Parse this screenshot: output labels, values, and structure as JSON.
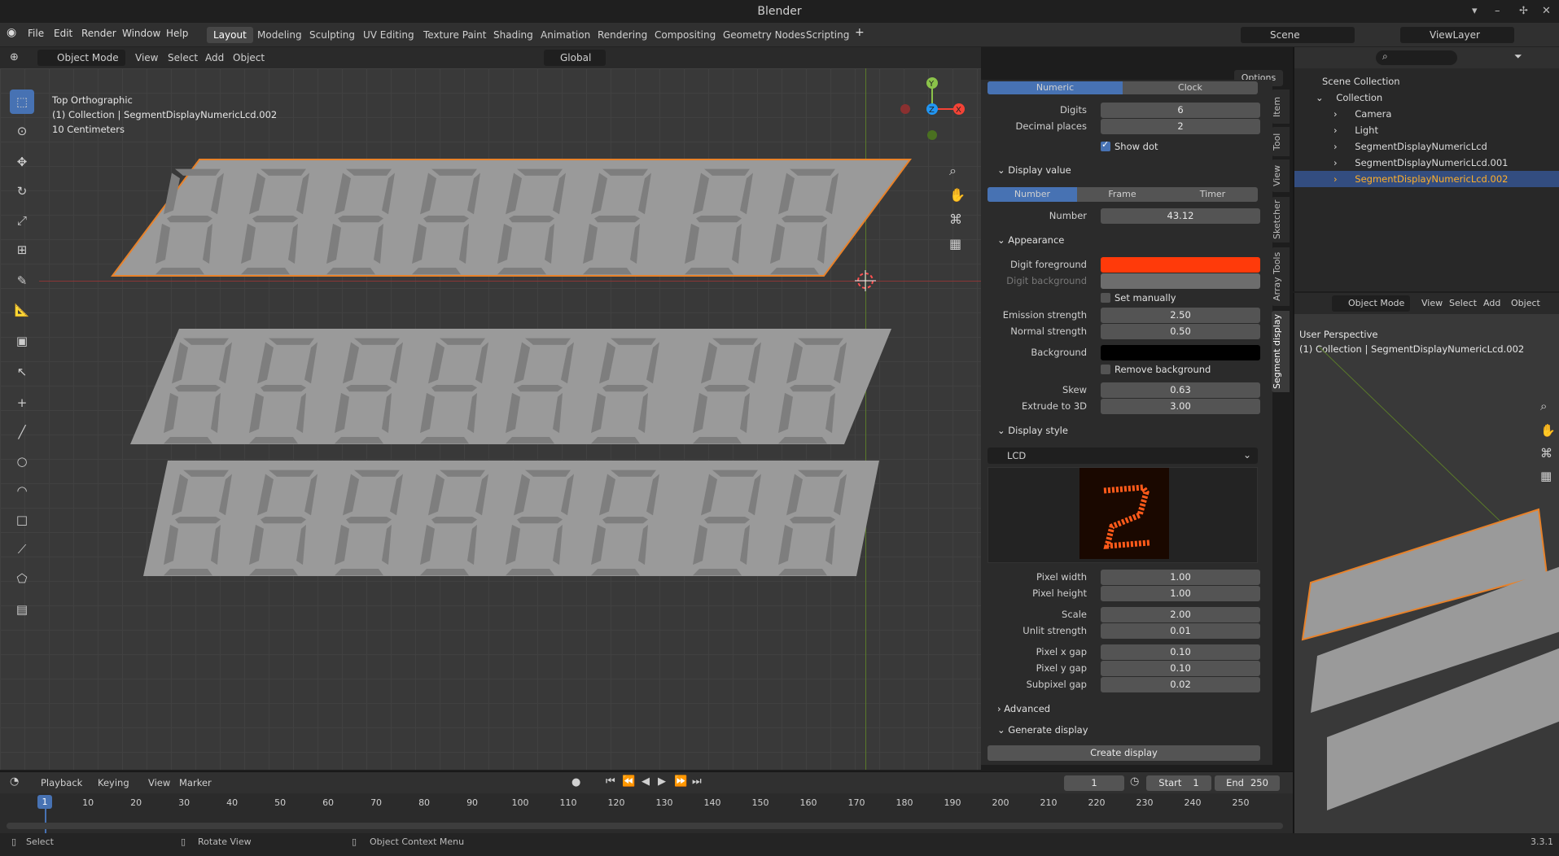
{
  "app": {
    "title": "Blender",
    "version": "3.3.1"
  },
  "menu": [
    "File",
    "Edit",
    "Render",
    "Window",
    "Help"
  ],
  "workspaces": [
    "Layout",
    "Modeling",
    "Sculpting",
    "UV Editing",
    "Texture Paint",
    "Shading",
    "Animation",
    "Rendering",
    "Compositing",
    "Geometry Nodes",
    "Scripting"
  ],
  "scene": {
    "scene_name": "Scene",
    "view_layer": "ViewLayer"
  },
  "viewport": {
    "mode": "Object Mode",
    "menus": [
      "View",
      "Select",
      "Add",
      "Object"
    ],
    "orientation": "Global",
    "options": "Options",
    "overlay": {
      "view": "Top Orthographic",
      "collection": "(1) Collection | SegmentDisplayNumericLcd.002",
      "scale": "10 Centimeters"
    }
  },
  "panel": {
    "tabs": [
      "Numeric",
      "Clock"
    ],
    "digits_label": "Digits",
    "digits": "6",
    "decimal_label": "Decimal places",
    "decimal": "2",
    "show_dot": "Show dot",
    "display_value": "Display value",
    "value_tabs": [
      "Number",
      "Frame",
      "Timer"
    ],
    "number_label": "Number",
    "number": "43.12",
    "appearance": "Appearance",
    "digit_fg_label": "Digit foreground",
    "digit_fg_color": "#ff3a0a",
    "digit_bg_label": "Digit background",
    "digit_bg_color": "#9a9a9a",
    "set_manually": "Set manually",
    "emission_label": "Emission strength",
    "emission": "2.50",
    "normal_label": "Normal strength",
    "normal": "0.50",
    "background_label": "Background",
    "background_color": "#000000",
    "remove_bg": "Remove background",
    "skew_label": "Skew",
    "skew": "0.63",
    "extrude_label": "Extrude to 3D",
    "extrude": "3.00",
    "display_style": "Display style",
    "style_value": "LCD",
    "pixel_width_label": "Pixel width",
    "pixel_width": "1.00",
    "pixel_height_label": "Pixel height",
    "pixel_height": "1.00",
    "scale_label": "Scale",
    "scale": "2.00",
    "unlit_label": "Unlit strength",
    "unlit": "0.01",
    "pxgap_label": "Pixel x gap",
    "pxgap": "0.10",
    "pygap_label": "Pixel y gap",
    "pygap": "0.10",
    "subgap_label": "Subpixel gap",
    "subgap": "0.02",
    "advanced": "Advanced",
    "generate": "Generate display",
    "create": "Create display"
  },
  "side_tabs": [
    "Item",
    "Tool",
    "View",
    "Sketcher",
    "Array Tools",
    "Segment display"
  ],
  "outliner": {
    "root": "Scene Collection",
    "collection": "Collection",
    "items": [
      "Camera",
      "Light",
      "SegmentDisplayNumericLcd",
      "SegmentDisplayNumericLcd.001",
      "SegmentDisplayNumericLcd.002"
    ]
  },
  "viewport2": {
    "mode": "Object Mode",
    "menus": [
      "View",
      "Select",
      "Add",
      "Object"
    ],
    "view": "User Perspective",
    "collection": "(1) Collection | SegmentDisplayNumericLcd.002"
  },
  "timeline": {
    "menus": [
      "Playback",
      "Keying",
      "View",
      "Marker"
    ],
    "current": "1",
    "start_label": "Start",
    "start": "1",
    "end_label": "End",
    "end": "250",
    "ticks": [
      "1",
      "10",
      "20",
      "30",
      "40",
      "50",
      "60",
      "70",
      "80",
      "90",
      "100",
      "110",
      "120",
      "130",
      "140",
      "150",
      "160",
      "170",
      "180",
      "190",
      "200",
      "210",
      "220",
      "230",
      "240",
      "250"
    ]
  },
  "statusbar": {
    "select": "Select",
    "rotate": "Rotate View",
    "context": "Object Context Menu"
  }
}
